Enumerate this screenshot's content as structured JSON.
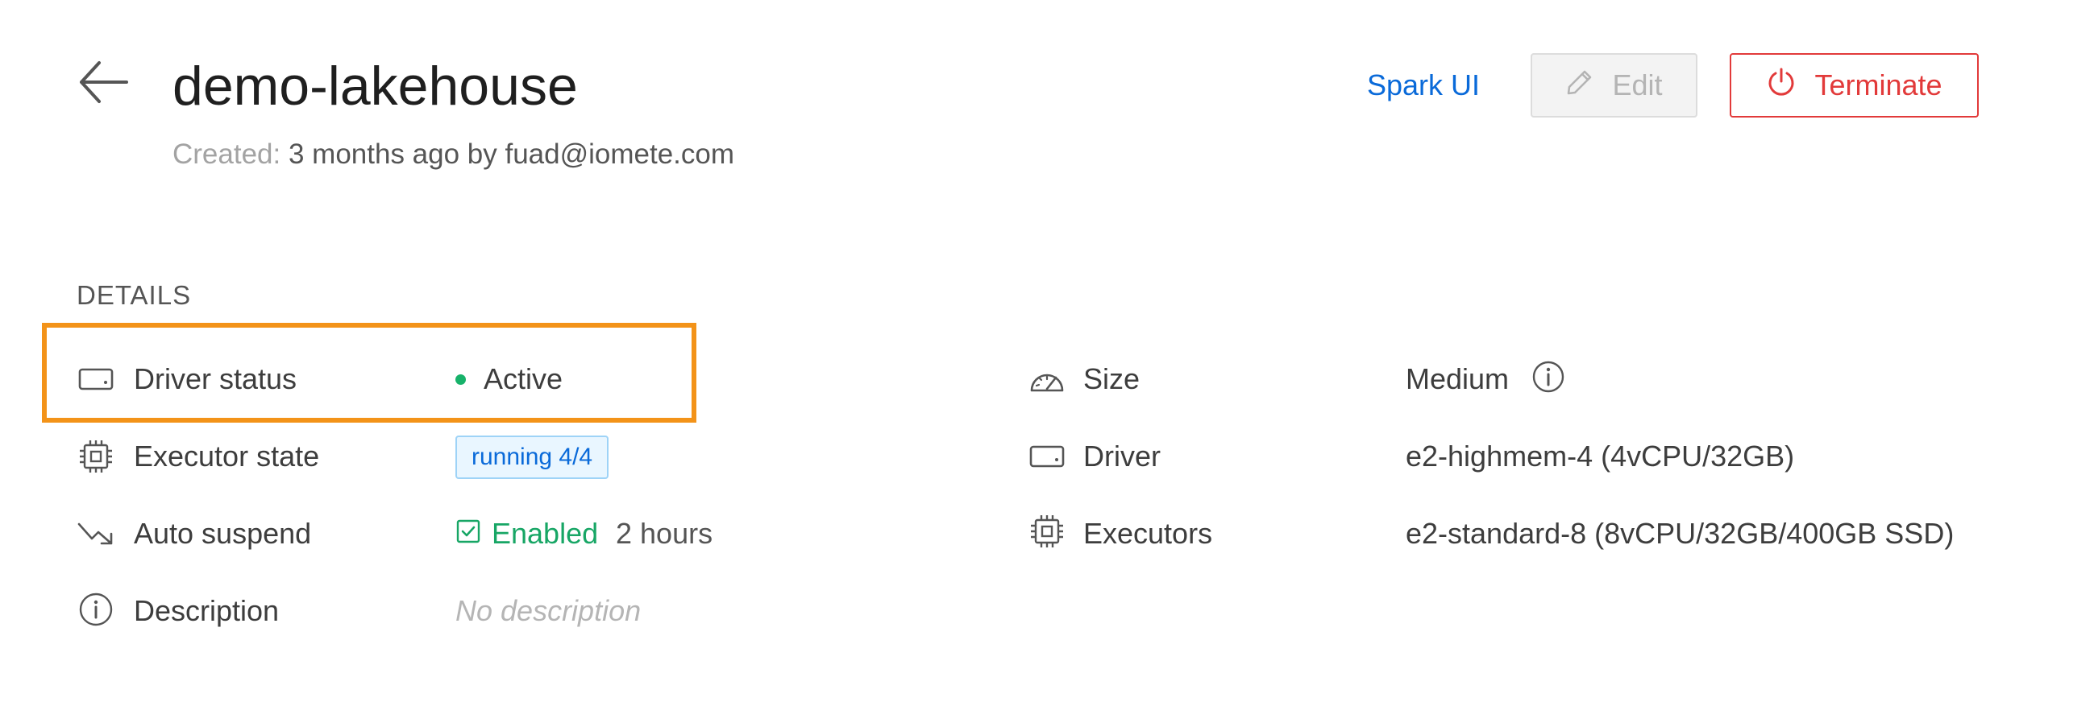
{
  "header": {
    "title": "demo-lakehouse",
    "created_label": "Created:",
    "created_value": "3 months ago by fuad@iomete.com",
    "spark_ui_label": "Spark UI",
    "edit_label": "Edit",
    "terminate_label": "Terminate",
    "colors": {
      "link": "#0a6ad9",
      "danger": "#e23a3a",
      "disabled": "#b4b4b4"
    }
  },
  "details": {
    "heading": "DETAILS",
    "highlight_color": "#f39319",
    "left": {
      "driver_status": {
        "label": "Driver status",
        "value": "Active",
        "icon": "hard-drive-icon",
        "status_color": "#17b26a"
      },
      "executor_state": {
        "label": "Executor state",
        "value": "running 4/4",
        "icon": "cpu-chip-icon"
      },
      "auto_suspend": {
        "label": "Auto suspend",
        "enabled": "Enabled",
        "duration": "2 hours",
        "icon": "trend-down-icon"
      },
      "description": {
        "label": "Description",
        "value": "No description",
        "icon": "info-circle-icon"
      }
    },
    "right": {
      "size": {
        "label": "Size",
        "value": "Medium",
        "icon": "gauge-icon"
      },
      "driver": {
        "label": "Driver",
        "value": "e2-highmem-4 (4vCPU/32GB)",
        "icon": "hard-drive-icon"
      },
      "executors": {
        "label": "Executors",
        "value": "e2-standard-8 (8vCPU/32GB/400GB SSD)",
        "icon": "cpu-chip-icon"
      }
    }
  }
}
